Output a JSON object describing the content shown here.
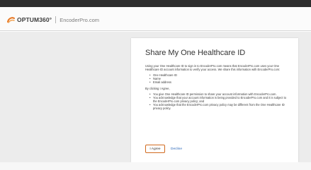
{
  "header": {
    "brand": "OPTUM360°",
    "product": "EncoderPro.com"
  },
  "card": {
    "title": "Share My One Healthcare ID",
    "intro": "Using your One Healthcare ID to sign in to EncoderPro.com means that EncoderPro.com uses your One Healthcare ID account information to verify your access. We share this information with EncoderPro.com:",
    "shared_items": [
      "One Healthcare ID",
      "Name",
      "Email address"
    ],
    "consent_lead": "By clicking I Agree,",
    "consent_items": [
      "You give One Healthcare ID permission to share your account information with EncoderPro.com.",
      "You acknowledge that your account information is being provided to EncoderPro.com and it is subject to the EncoderPro.com privacy policy; and",
      "You acknowledge that the EncoderPro.com privacy policy may be different from the One Healthcare ID privacy policy."
    ],
    "agree_label": "I Agree",
    "decline_label": "Decline"
  },
  "colors": {
    "accent": "#d16a1f",
    "link": "#2a66b8",
    "topbar": "#2e2e2e",
    "background": "#ececec"
  }
}
